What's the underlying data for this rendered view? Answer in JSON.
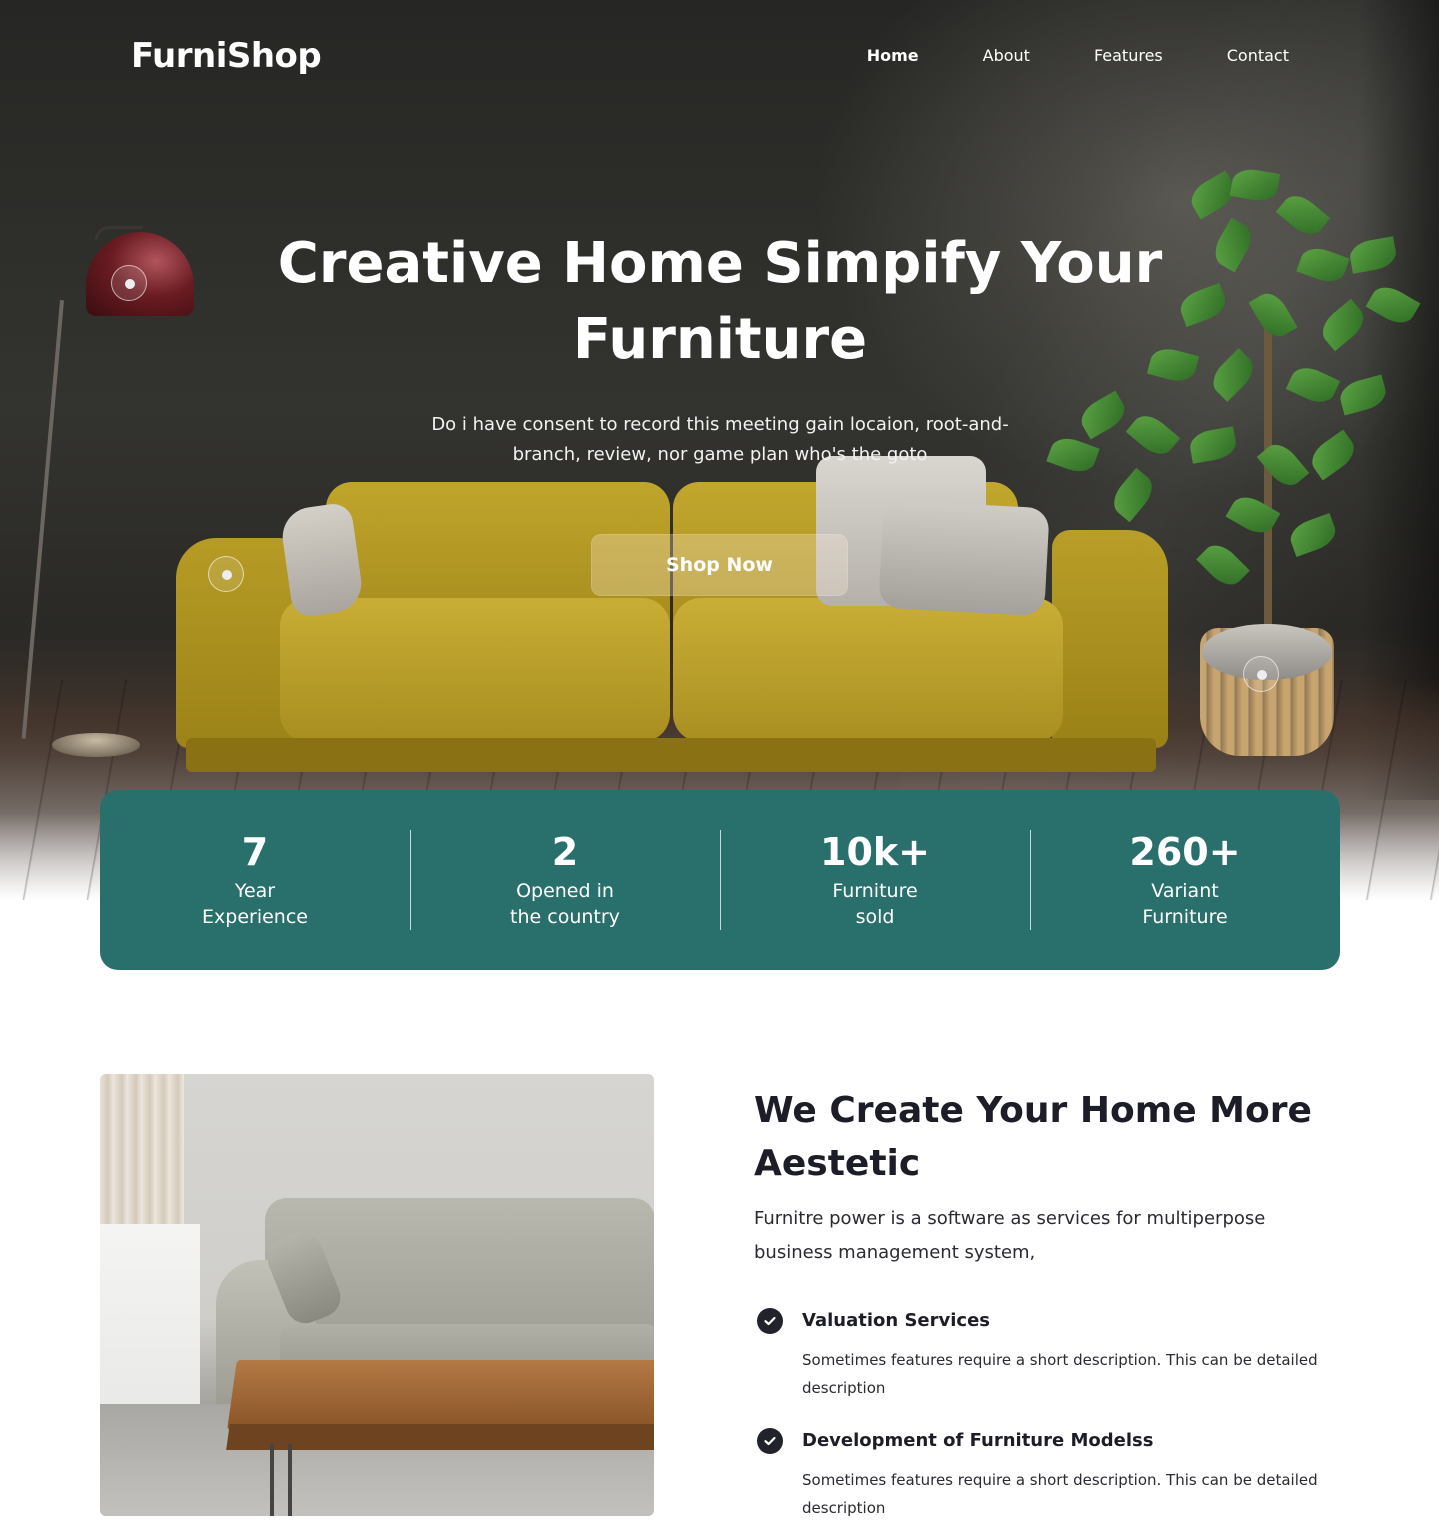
{
  "brand": {
    "logo": "FurniShop"
  },
  "nav": {
    "items": [
      {
        "label": "Home",
        "active": true
      },
      {
        "label": "About",
        "active": false
      },
      {
        "label": "Features",
        "active": false
      },
      {
        "label": "Contact",
        "active": false
      }
    ]
  },
  "hero": {
    "title": "Creative Home Simpify Your Furniture",
    "subtitle": "Do i have consent to record this meeting gain locaion, root-and-branch, review, nor game plan who's the goto",
    "cta_label": "Shop Now"
  },
  "stats": [
    {
      "value": "7",
      "label": "Year\nExperience"
    },
    {
      "value": "2",
      "label": "Opened in\nthe country"
    },
    {
      "value": "10k+",
      "label": "Furniture\nsold"
    },
    {
      "value": "260+",
      "label": "Variant\nFurniture"
    }
  ],
  "about": {
    "title": "We Create Your Home More Aestetic",
    "text": "Furnitre power is a software as services for multiperpose business management system,",
    "features": [
      {
        "title": "Valuation Services",
        "description": "Sometimes features require a short description.  This can be detailed description"
      },
      {
        "title": "Development of Furniture Modelss",
        "description": "Sometimes features require a short description. This can be detailed description"
      }
    ]
  },
  "colors": {
    "stats_bg": "#29706c",
    "heading": "#1d1d27",
    "hero_text": "#ffffff"
  },
  "icons": {
    "feature_check": "check-circle-icon",
    "hotspot": "hotspot-dot-icon"
  }
}
